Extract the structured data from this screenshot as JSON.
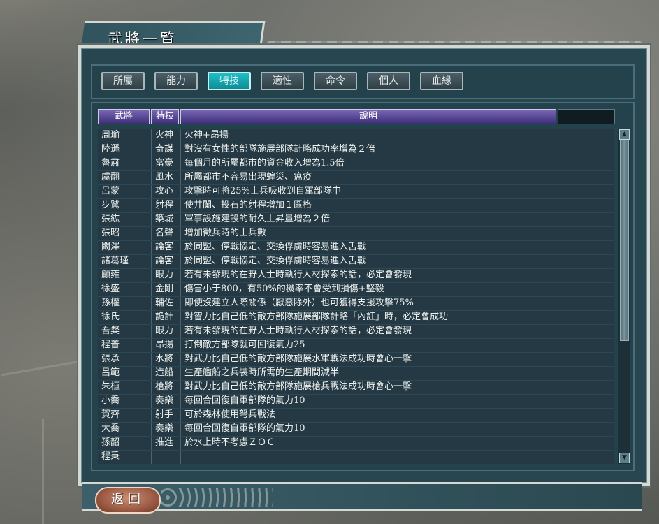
{
  "window": {
    "title": "武將一覧"
  },
  "tabs": [
    {
      "label": "所屬",
      "active": false
    },
    {
      "label": "能力",
      "active": false
    },
    {
      "label": "特技",
      "active": true
    },
    {
      "label": "適性",
      "active": false
    },
    {
      "label": "命令",
      "active": false
    },
    {
      "label": "個人",
      "active": false
    },
    {
      "label": "血緣",
      "active": false
    }
  ],
  "table": {
    "headers": [
      "武將",
      "特技",
      "說明",
      ""
    ],
    "rows": [
      {
        "name": "周瑜",
        "skill": "火神",
        "desc": "火神+昂揚"
      },
      {
        "name": "陸遜",
        "skill": "奇謀",
        "desc": "對沒有女性的部隊施展部隊計略成功率增為２倍"
      },
      {
        "name": "魯肅",
        "skill": "富豪",
        "desc": "每個月的所屬都市的資金收入增為1.5倍"
      },
      {
        "name": "虞翻",
        "skill": "風水",
        "desc": "所屬都市不容易出現蝗災、瘟疫"
      },
      {
        "name": "呂蒙",
        "skill": "攻心",
        "desc": "攻擊時可將25%士兵吸收到自軍部隊中"
      },
      {
        "name": "步騭",
        "skill": "射程",
        "desc": "使井闌、投石的射程增加１區格"
      },
      {
        "name": "張紘",
        "skill": "築城",
        "desc": "軍事設施建設的耐久上昇量增為２倍"
      },
      {
        "name": "張昭",
        "skill": "名聲",
        "desc": "增加徵兵時的士兵數"
      },
      {
        "name": "闞澤",
        "skill": "論客",
        "desc": "於同盟、停戰協定、交換俘虜時容易進入舌戰"
      },
      {
        "name": "諸葛瑾",
        "skill": "論客",
        "desc": "於同盟、停戰協定、交換俘虜時容易進入舌戰"
      },
      {
        "name": "顧雍",
        "skill": "眼力",
        "desc": "若有未發現的在野人士時執行人材探索的話，必定會發現"
      },
      {
        "name": "徐盛",
        "skill": "金剛",
        "desc": "傷害小于800，有50%的機率不會受到損傷+堅毅"
      },
      {
        "name": "孫權",
        "skill": "輔佐",
        "desc": "即使沒建立人際關係（厭惡除外）也可獲得支援攻擊75%"
      },
      {
        "name": "徐氏",
        "skill": "詭計",
        "desc": "對智力比自己低的敵方部隊施展部隊計略「內訌」時，必定會成功"
      },
      {
        "name": "吾粲",
        "skill": "眼力",
        "desc": "若有未發現的在野人士時執行人材探索的話，必定會發現"
      },
      {
        "name": "程普",
        "skill": "昂揚",
        "desc": "打倒敵方部隊就可回復氣力25"
      },
      {
        "name": "張承",
        "skill": "水將",
        "desc": "對武力比自己低的敵方部隊施展水軍戰法成功時會心一擊"
      },
      {
        "name": "呂範",
        "skill": "造船",
        "desc": "生產艦船之兵裝時所需的生產期間減半"
      },
      {
        "name": "朱桓",
        "skill": "槍將",
        "desc": "對武力比自己低的敵方部隊施展槍兵戰法成功時會心一擊"
      },
      {
        "name": "小喬",
        "skill": "奏樂",
        "desc": "每回合回復自軍部隊的氣力10"
      },
      {
        "name": "賀齊",
        "skill": "射手",
        "desc": "可於森林使用弩兵戰法"
      },
      {
        "name": "大喬",
        "skill": "奏樂",
        "desc": "每回合回復自軍部隊的氣力10"
      },
      {
        "name": "孫韶",
        "skill": "推進",
        "desc": "於水上時不考慮ＺＯＣ"
      },
      {
        "name": "程秉",
        "skill": "",
        "desc": ""
      }
    ]
  },
  "footer": {
    "back_label": "返回"
  },
  "scrollbar": {
    "up": "▲",
    "down": "▼"
  },
  "colors": {
    "accent_tab": "#1fbec5",
    "header": "#5a4a9a",
    "panel": "#274650"
  }
}
